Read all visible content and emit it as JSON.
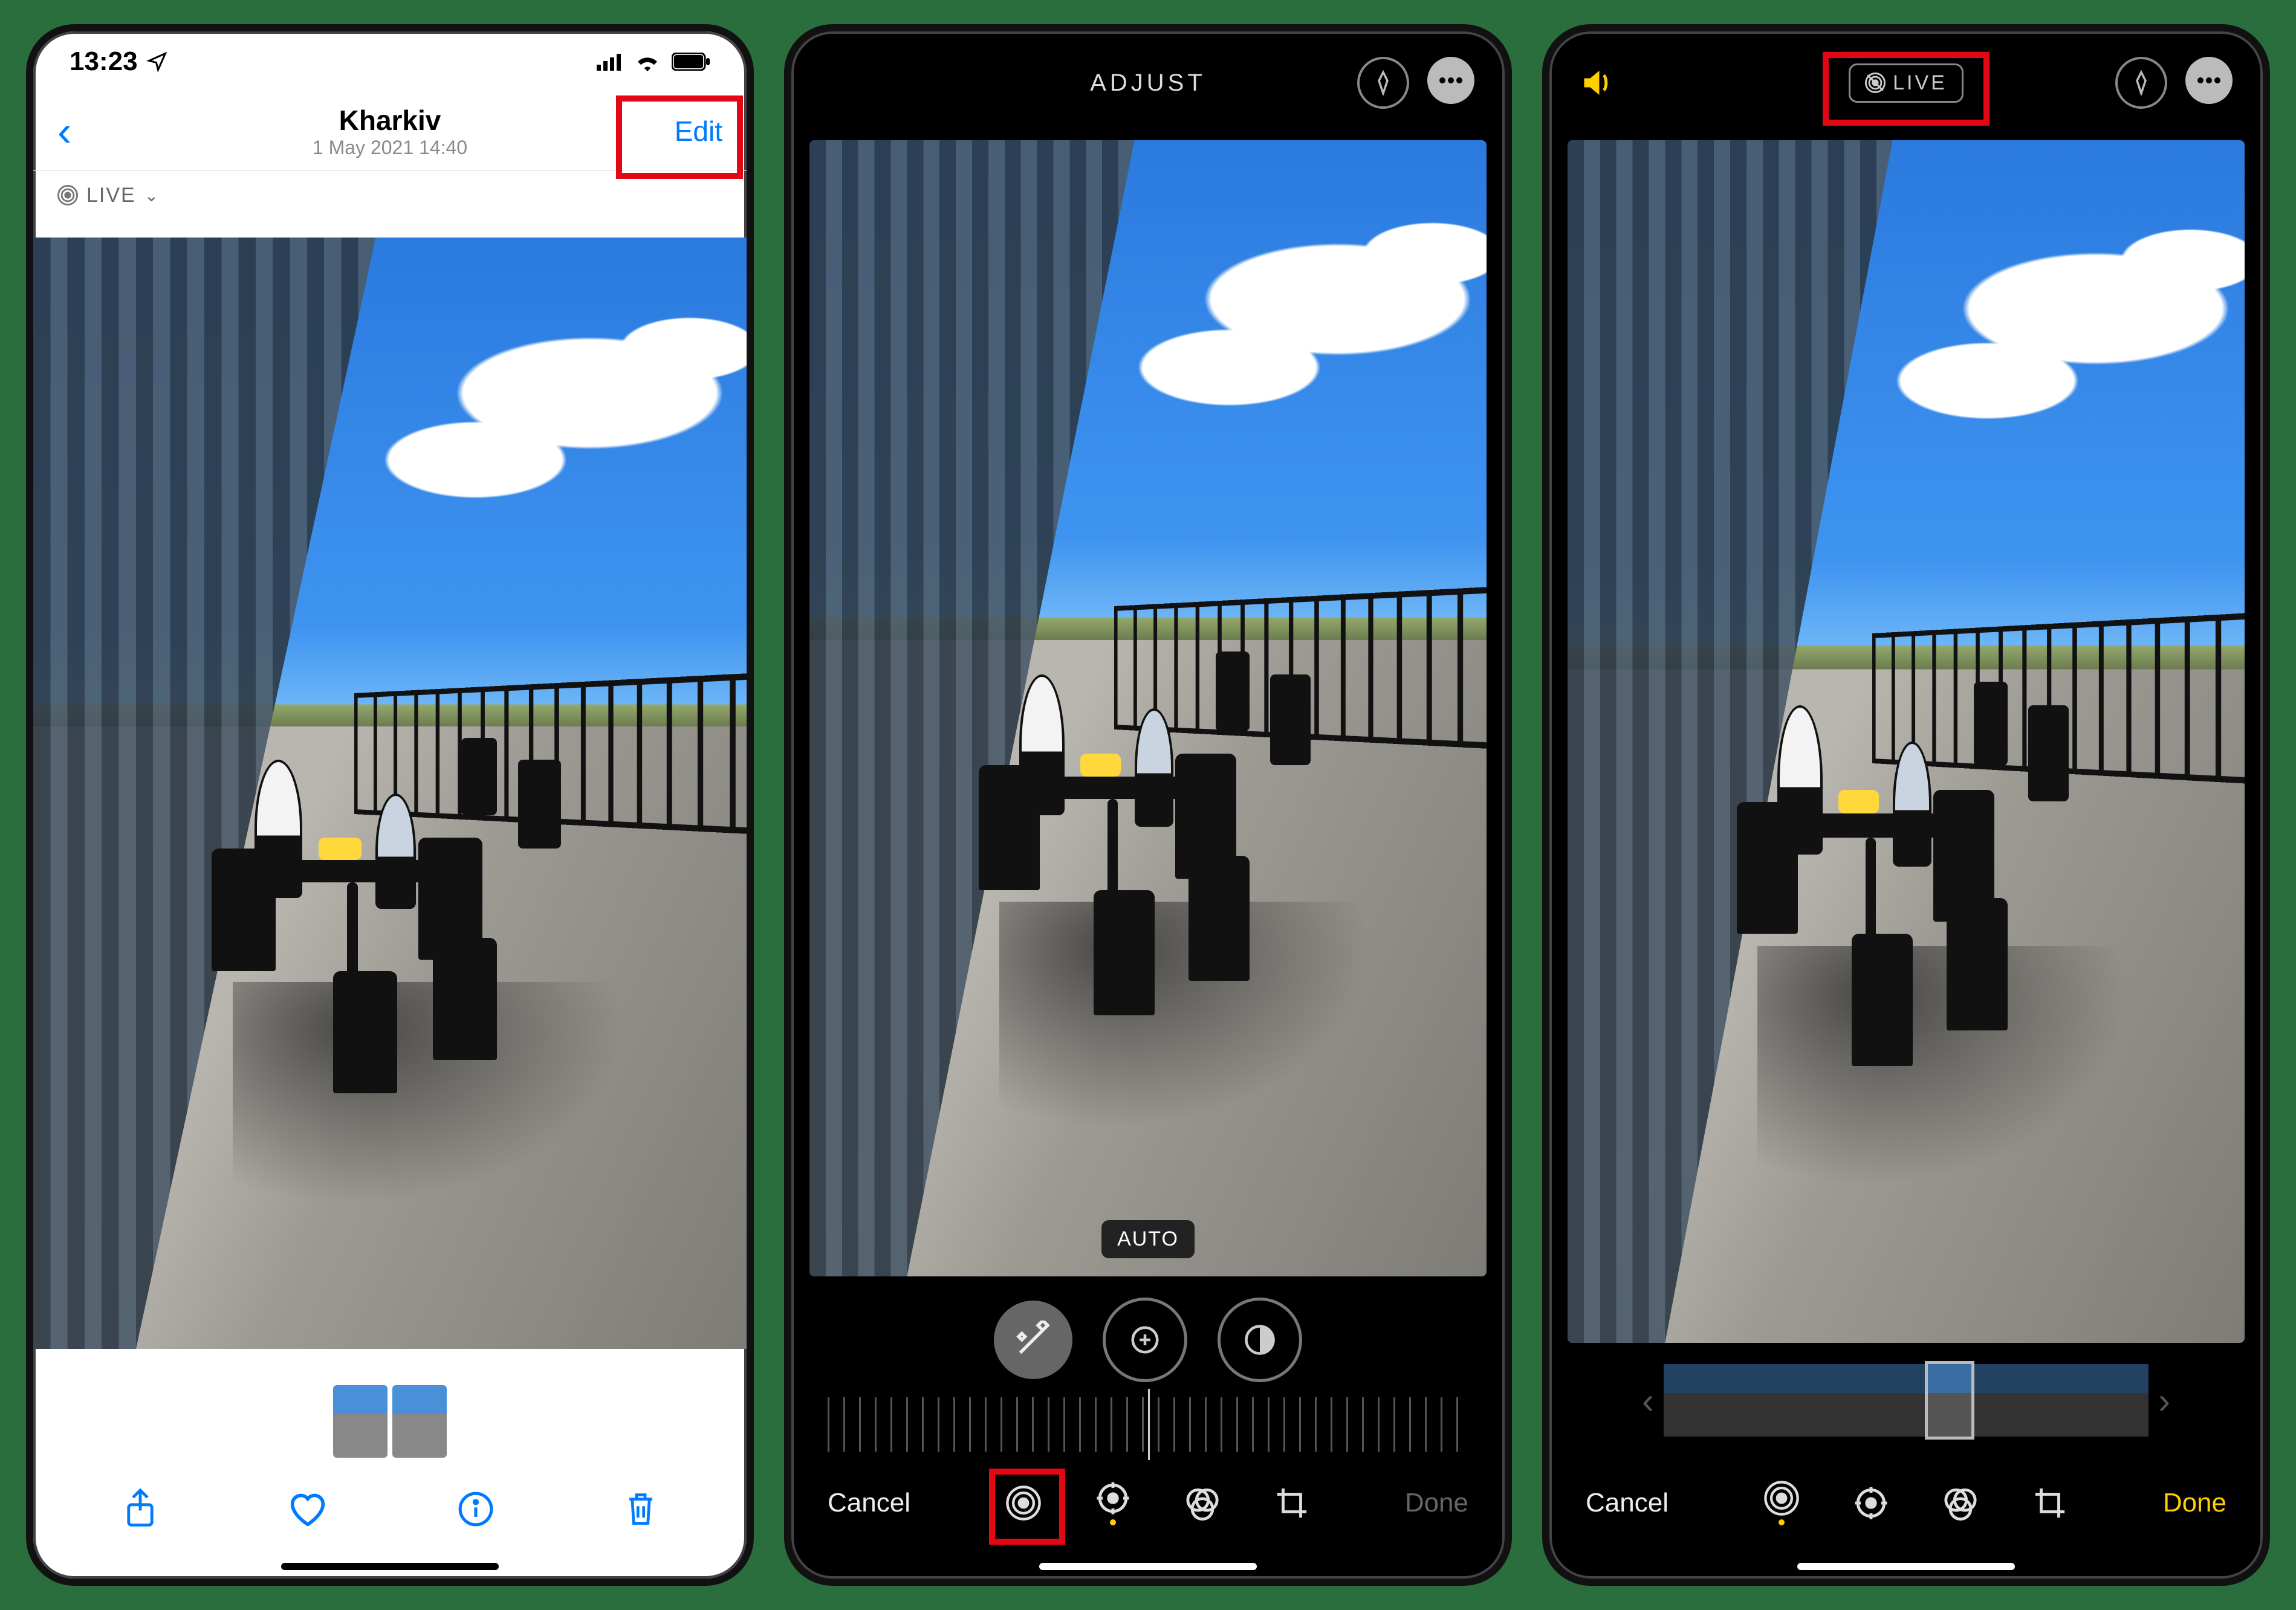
{
  "screen1": {
    "status": {
      "time": "13:23"
    },
    "nav": {
      "title": "Kharkiv",
      "subtitle": "1 May 2021  14:40",
      "edit": "Edit"
    },
    "live_badge": "LIVE"
  },
  "screen2": {
    "header": {
      "mode": "ADJUST"
    },
    "auto_label": "AUTO",
    "footer": {
      "cancel": "Cancel",
      "done": "Done"
    }
  },
  "screen3": {
    "header": {
      "live": "LIVE"
    },
    "footer": {
      "cancel": "Cancel",
      "done": "Done"
    }
  }
}
